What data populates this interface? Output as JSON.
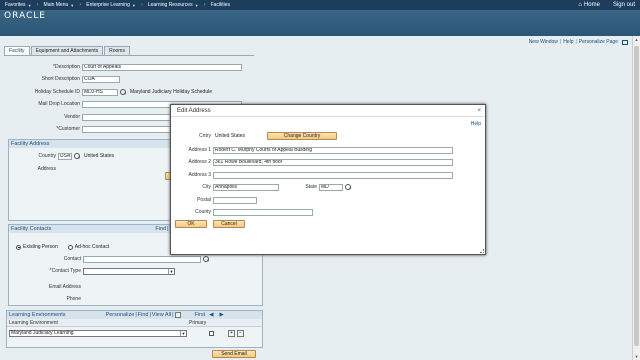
{
  "nav": {
    "items": [
      {
        "label": "Favorites"
      },
      {
        "label": "Main Menu"
      },
      {
        "label": "Enterprise Learning"
      },
      {
        "label": "Learning Resources"
      },
      {
        "label": "Facilities"
      }
    ],
    "home": "Home",
    "signout": "Sign out"
  },
  "header": {
    "logo": "ORACLE"
  },
  "pagelinks": {
    "new_window": "New Window",
    "help": "Help",
    "personalize": "Personalize Page"
  },
  "tabs": [
    {
      "label": "Facility"
    },
    {
      "label": "Equipment and Attachments"
    },
    {
      "label": "Rooms"
    }
  ],
  "form": {
    "description_label": "*Description",
    "description_value": "Court of Appeals",
    "short_desc_label": "Short Description",
    "short_desc_value": "COA",
    "holiday_label": "Holiday Schedule ID",
    "holiday_value": "MDJ-HS",
    "holiday_desc": "Maryland Judiciary Holiday Schedule",
    "maildrop_label": "Mail Drop Location",
    "vendor_label": "Vendor",
    "customer_label": "*Customer"
  },
  "facility_address": {
    "header": "Facility Address",
    "country_label": "Country",
    "country_value": "USA",
    "country_desc": "United States",
    "address_label": "Address"
  },
  "facility_contacts": {
    "header": "Facility Contacts",
    "find": "Find",
    "view": "Vi",
    "existing": "Existing Person",
    "adhoc": "Ad-hoc Contact",
    "contact_label": "Contact",
    "contact_type_label": "*Contact Type",
    "email_label": "Email Address",
    "phone_label": "Phone"
  },
  "learning_env": {
    "header": "Learning Environments",
    "personalize": "Personalize",
    "find": "Find",
    "view_all": "View All",
    "first": "First",
    "col_env": "Learning Environment",
    "col_primary": "Primary",
    "row_value": "Maryland Judiciary Learning",
    "send_email": "Send Email"
  },
  "modal": {
    "title": "Edit Address",
    "help": "Help",
    "cntry_label": "Cntry",
    "cntry_value": "United States",
    "change_country": "Change Country",
    "address1_label": "Address 1",
    "address1_value": "Robert C. Murphy Courts of Appeal Building",
    "address2_label": "Address 2",
    "address2_value": "361 Rowe Boulevard, 4th floor",
    "address3_label": "Address 3",
    "address3_value": "",
    "city_label": "City",
    "city_value": "Annapolis",
    "state_label": "State",
    "state_value": "MD",
    "postal_label": "Postal",
    "postal_value": "",
    "county_label": "County",
    "county_value": "",
    "ok": "OK",
    "cancel": "Cancel"
  },
  "colors": {
    "nav_bg": "#1c3d5c",
    "header_bg": "#2b5676",
    "button_bg": "#f3c981",
    "link": "#1f4e79"
  }
}
